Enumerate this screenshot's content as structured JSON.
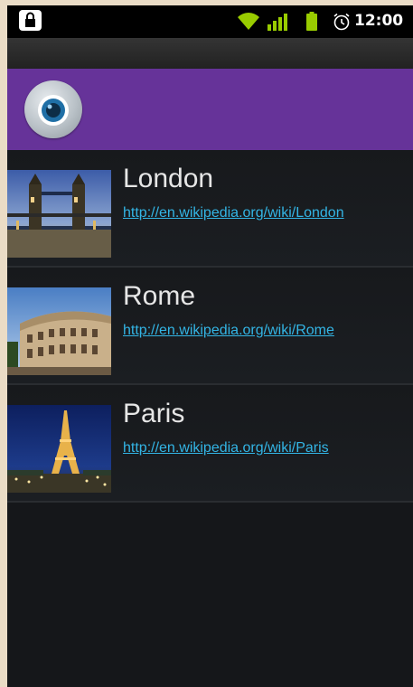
{
  "status_bar": {
    "time": "12:00",
    "icons": [
      "lock-icon",
      "wifi-icon",
      "signal-icon",
      "battery-icon",
      "alarm-icon"
    ]
  },
  "action_bar": {
    "logo_icon": "camera-lens-icon",
    "color": "#663399"
  },
  "cities": [
    {
      "name": "London",
      "url": "http://en.wikipedia.org/wiki/London",
      "image": "tower-bridge-image"
    },
    {
      "name": "Rome",
      "url": "http://en.wikipedia.org/wiki/Rome",
      "image": "colosseum-image"
    },
    {
      "name": "Paris",
      "url": "http://en.wikipedia.org/wiki/Paris",
      "image": "eiffel-tower-image"
    }
  ],
  "colors": {
    "link": "#33b5e5",
    "accent": "#663399",
    "battery": "#99cc00",
    "wifi": "#99cc00"
  }
}
